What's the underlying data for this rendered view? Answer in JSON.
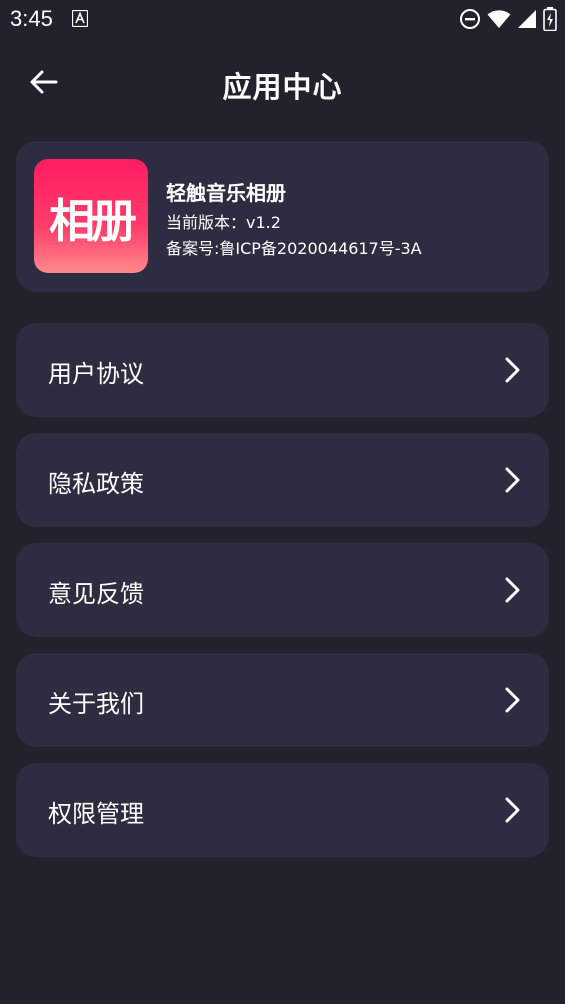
{
  "status_bar": {
    "time": "3:45",
    "icons": [
      "a-notification-icon",
      "dnd-icon",
      "wifi-icon",
      "signal-icon",
      "battery-icon"
    ]
  },
  "header": {
    "title": "应用中心",
    "back_icon": "arrow-left-icon"
  },
  "app_info": {
    "logo_text": "相册",
    "name": "轻触音乐相册",
    "version": "当前版本：v1.2",
    "record": "备案号:鲁ICP备2020044617号-3A"
  },
  "menu": {
    "items": [
      {
        "label": "用户协议",
        "icon": "chevron-right-icon"
      },
      {
        "label": "隐私政策",
        "icon": "chevron-right-icon"
      },
      {
        "label": "意见反馈",
        "icon": "chevron-right-icon"
      },
      {
        "label": "关于我们",
        "icon": "chevron-right-icon"
      },
      {
        "label": "权限管理",
        "icon": "chevron-right-icon"
      }
    ]
  },
  "colors": {
    "background": "#23222c",
    "card": "#2e2c41",
    "logo_gradient_top": "#ff1c62",
    "logo_gradient_bottom": "#ff8a8a",
    "text": "#ffffff"
  }
}
